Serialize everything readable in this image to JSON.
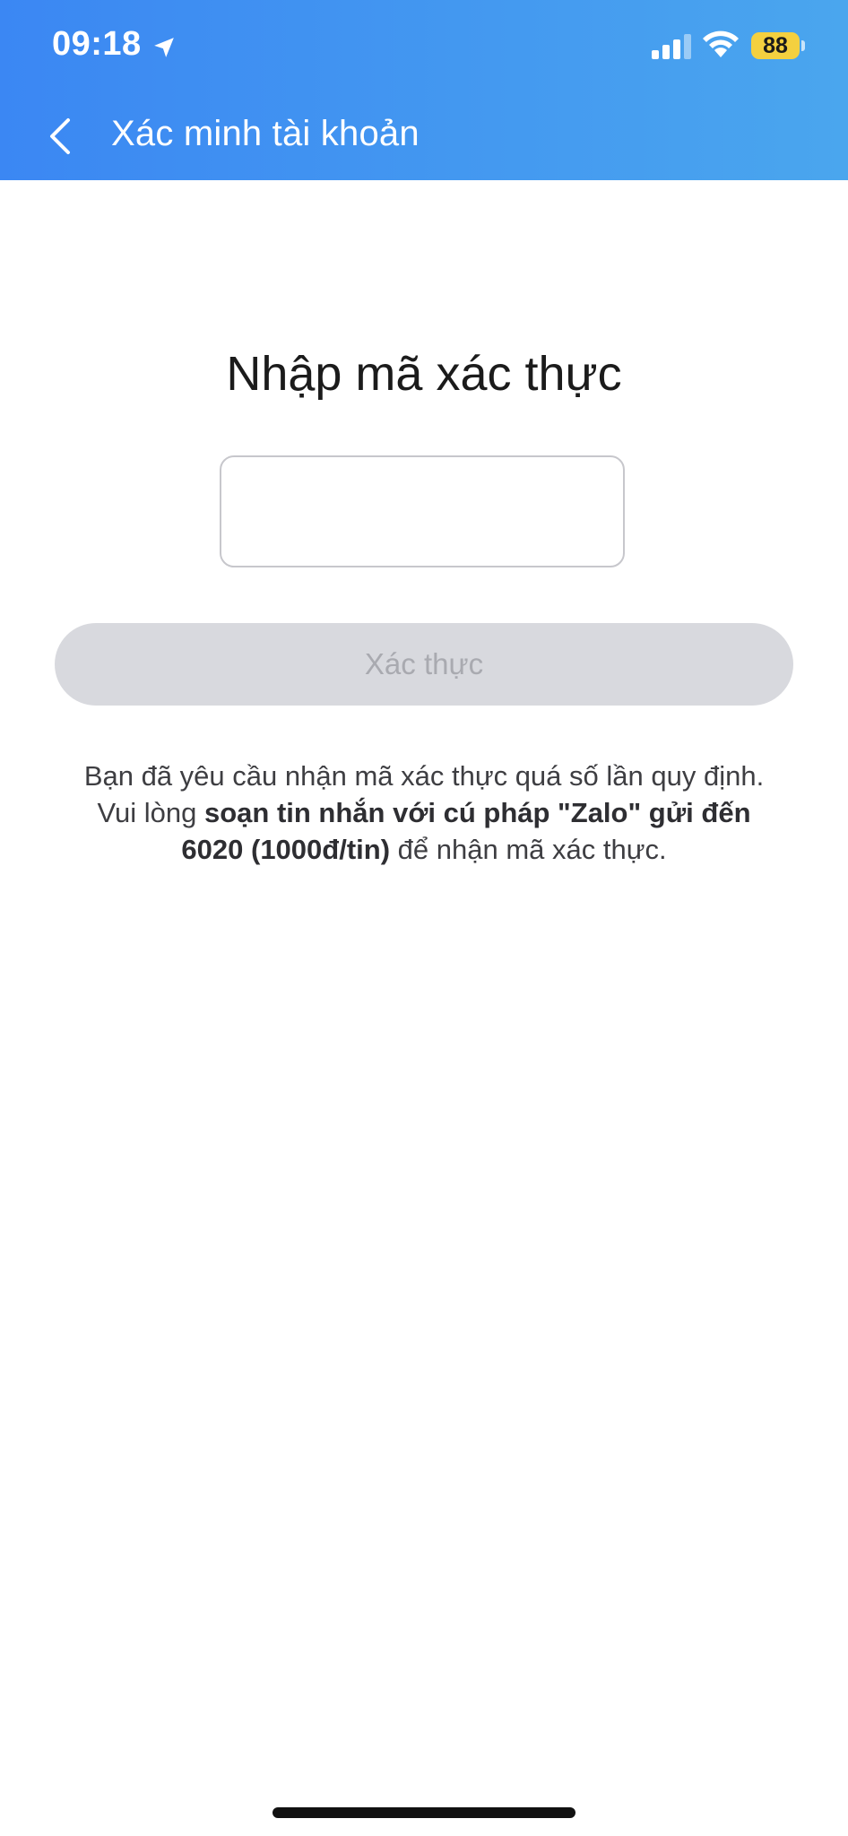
{
  "status_bar": {
    "time": "09:18",
    "battery": "88",
    "battery_color": "#f4d03f"
  },
  "header": {
    "title": "Xác minh tài khoản",
    "back_icon": "chevron-left-icon",
    "gradient": [
      "#3b87f3",
      "#4aa6ee"
    ]
  },
  "main": {
    "heading": "Nhập mã xác thực",
    "code_input": {
      "value": "",
      "placeholder": ""
    },
    "verify_button": "Xác thực",
    "notice": {
      "line1": "Bạn đã yêu cầu nhận mã xác thực quá số lần quy định.",
      "line2_prefix": "Vui lòng ",
      "line2_bold": "soạn tin nhắn với cú pháp \"Zalo\" gửi đến",
      "line3_bold": "6020 (1000đ/tin)",
      "line3_suffix": " để nhận mã xác thực."
    }
  }
}
